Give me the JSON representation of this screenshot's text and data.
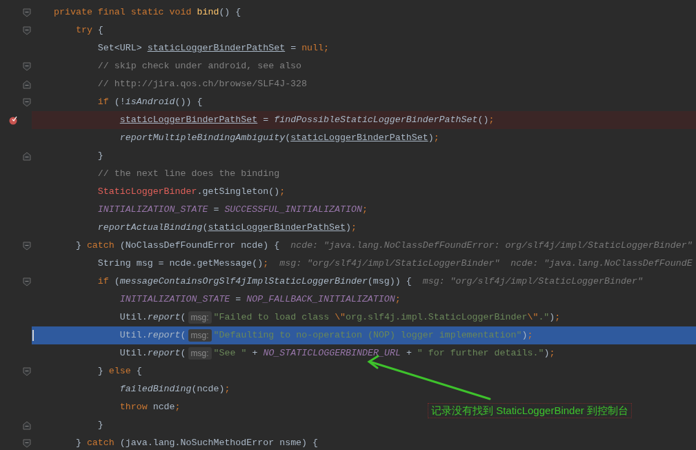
{
  "editor": {
    "lines": [
      {
        "breakpoint": false,
        "current": false,
        "fold_open": true,
        "fold_close": false,
        "tokens": [
          {
            "kind": "kw",
            "text": "private final static void "
          },
          {
            "kind": "fn",
            "text": "bind"
          },
          {
            "kind": "p",
            "text": "() {"
          }
        ]
      },
      {
        "breakpoint": false,
        "current": false,
        "fold_open": true,
        "fold_close": false,
        "tokens": [
          {
            "kind": "kw",
            "text": "    try"
          },
          {
            "kind": "p",
            "text": " {"
          }
        ]
      },
      {
        "breakpoint": false,
        "current": false,
        "fold_open": false,
        "fold_close": false,
        "tokens": [
          {
            "kind": "p",
            "text": "        Set<URL> "
          },
          {
            "kind": "u",
            "text": "staticLoggerBinderPathSet"
          },
          {
            "kind": "p",
            "text": " = "
          },
          {
            "kind": "kw",
            "text": "null;"
          }
        ]
      },
      {
        "breakpoint": false,
        "current": false,
        "fold_open": true,
        "fold_close": false,
        "tokens": [
          {
            "kind": "c",
            "text": "        // skip check under android, see also"
          }
        ]
      },
      {
        "breakpoint": false,
        "current": false,
        "fold_open": false,
        "fold_close": true,
        "tokens": [
          {
            "kind": "c",
            "text": "        // http://jira.qos.ch/browse/SLF4J-328"
          }
        ]
      },
      {
        "breakpoint": false,
        "current": false,
        "fold_open": true,
        "fold_close": false,
        "tokens": [
          {
            "kind": "kw",
            "text": "        if"
          },
          {
            "kind": "p",
            "text": " (!"
          },
          {
            "kind": "m",
            "text": "isAndroid"
          },
          {
            "kind": "p",
            "text": "()) {"
          }
        ]
      },
      {
        "breakpoint": true,
        "current": false,
        "fold_open": false,
        "fold_close": false,
        "tokens": [
          {
            "kind": "u",
            "text": "            staticLoggerBinderPathSet"
          },
          {
            "kind": "p",
            "text": " = "
          },
          {
            "kind": "m",
            "text": "findPossibleStaticLoggerBinderPathSet"
          },
          {
            "kind": "p",
            "text": "()"
          },
          {
            "kind": "kw",
            "text": ";"
          }
        ]
      },
      {
        "breakpoint": false,
        "current": false,
        "fold_open": false,
        "fold_close": false,
        "tokens": [
          {
            "kind": "m",
            "text": "            reportMultipleBindingAmbiguity"
          },
          {
            "kind": "p",
            "text": "("
          },
          {
            "kind": "u",
            "text": "staticLoggerBinderPathSet"
          },
          {
            "kind": "p",
            "text": ")"
          },
          {
            "kind": "kw",
            "text": ";"
          }
        ]
      },
      {
        "breakpoint": false,
        "current": false,
        "fold_open": false,
        "fold_close": true,
        "tokens": [
          {
            "kind": "p",
            "text": "        }"
          }
        ]
      },
      {
        "breakpoint": false,
        "current": false,
        "fold_open": false,
        "fold_close": false,
        "tokens": [
          {
            "kind": "c",
            "text": "        // the next line does the binding"
          }
        ]
      },
      {
        "breakpoint": false,
        "current": false,
        "fold_open": false,
        "fold_close": false,
        "tokens": [
          {
            "kind": "cls",
            "text": "        StaticLoggerBinder"
          },
          {
            "kind": "p",
            "text": ".getSingleton()"
          },
          {
            "kind": "kw",
            "text": ";"
          }
        ]
      },
      {
        "breakpoint": false,
        "current": false,
        "fold_open": false,
        "fold_close": false,
        "tokens": [
          {
            "kind": "k",
            "text": "        INITIALIZATION_STATE"
          },
          {
            "kind": "p",
            "text": " = "
          },
          {
            "kind": "k",
            "text": "SUCCESSFUL_INITIALIZATION"
          },
          {
            "kind": "kw",
            "text": ";"
          }
        ]
      },
      {
        "breakpoint": false,
        "current": false,
        "fold_open": false,
        "fold_close": false,
        "tokens": [
          {
            "kind": "m",
            "text": "        reportActualBinding"
          },
          {
            "kind": "p",
            "text": "("
          },
          {
            "kind": "u",
            "text": "staticLoggerBinderPathSet"
          },
          {
            "kind": "p",
            "text": ")"
          },
          {
            "kind": "kw",
            "text": ";"
          }
        ]
      },
      {
        "breakpoint": false,
        "current": false,
        "fold_open": true,
        "fold_close": false,
        "tokens": [
          {
            "kind": "p",
            "text": "    } "
          },
          {
            "kind": "kw",
            "text": "catch"
          },
          {
            "kind": "p",
            "text": " (NoClassDefFoundError ncde) {"
          },
          {
            "kind": "hint",
            "text": "ncde: \"java.lang.NoClassDefFoundError: org/slf4j/impl/StaticLoggerBinder\""
          }
        ]
      },
      {
        "breakpoint": false,
        "current": false,
        "fold_open": false,
        "fold_close": false,
        "tokens": [
          {
            "kind": "p",
            "text": "        String msg = ncde.getMessage()"
          },
          {
            "kind": "kw",
            "text": ";"
          },
          {
            "kind": "hint",
            "text": "msg: \"org/slf4j/impl/StaticLoggerBinder\"  ncde: \"java.lang.NoClassDefFoundE"
          }
        ]
      },
      {
        "breakpoint": false,
        "current": false,
        "fold_open": true,
        "fold_close": false,
        "tokens": [
          {
            "kind": "kw",
            "text": "        if"
          },
          {
            "kind": "p",
            "text": " ("
          },
          {
            "kind": "m",
            "text": "messageContainsOrgSlf4jImplStaticLoggerBinder"
          },
          {
            "kind": "p",
            "text": "(msg)) {"
          },
          {
            "kind": "hint",
            "text": "msg: \"org/slf4j/impl/StaticLoggerBinder\""
          }
        ]
      },
      {
        "breakpoint": false,
        "current": false,
        "fold_open": false,
        "fold_close": false,
        "tokens": [
          {
            "kind": "k",
            "text": "            INITIALIZATION_STATE"
          },
          {
            "kind": "p",
            "text": " = "
          },
          {
            "kind": "k",
            "text": "NOP_FALLBACK_INITIALIZATION"
          },
          {
            "kind": "kw",
            "text": ";"
          }
        ]
      },
      {
        "breakpoint": false,
        "current": false,
        "fold_open": false,
        "fold_close": false,
        "tokens": [
          {
            "kind": "p",
            "text": "            Util."
          },
          {
            "kind": "m",
            "text": "report"
          },
          {
            "kind": "p",
            "text": "("
          },
          {
            "kind": "param",
            "text": "msg:"
          },
          {
            "kind": "s",
            "text": "\"Failed to load class "
          },
          {
            "kind": "kw",
            "text": "\\\""
          },
          {
            "kind": "s",
            "text": "org.slf4j.impl.StaticLoggerBinder"
          },
          {
            "kind": "kw",
            "text": "\\\""
          },
          {
            "kind": "s",
            "text": ".\""
          },
          {
            "kind": "p",
            "text": ")"
          },
          {
            "kind": "kw",
            "text": ";"
          }
        ]
      },
      {
        "breakpoint": false,
        "current": true,
        "fold_open": false,
        "fold_close": false,
        "tokens": [
          {
            "kind": "p",
            "text": "            Util."
          },
          {
            "kind": "m",
            "text": "report"
          },
          {
            "kind": "p",
            "text": "("
          },
          {
            "kind": "param",
            "text": "msg:"
          },
          {
            "kind": "s",
            "text": "\"Defaulting to no-operation (NOP) logger implementation\""
          },
          {
            "kind": "p",
            "text": ")"
          },
          {
            "kind": "kw",
            "text": ";"
          }
        ]
      },
      {
        "breakpoint": false,
        "current": false,
        "fold_open": false,
        "fold_close": false,
        "tokens": [
          {
            "kind": "p",
            "text": "            Util."
          },
          {
            "kind": "m",
            "text": "report"
          },
          {
            "kind": "p",
            "text": "("
          },
          {
            "kind": "param",
            "text": "msg:"
          },
          {
            "kind": "s",
            "text": "\"See \""
          },
          {
            "kind": "p",
            "text": " + "
          },
          {
            "kind": "k",
            "text": "NO_STATICLOGGERBINDER_URL"
          },
          {
            "kind": "p",
            "text": " + "
          },
          {
            "kind": "s",
            "text": "\" for further details.\""
          },
          {
            "kind": "p",
            "text": ")"
          },
          {
            "kind": "kw",
            "text": ";"
          }
        ]
      },
      {
        "breakpoint": false,
        "current": false,
        "fold_open": true,
        "fold_close": false,
        "tokens": [
          {
            "kind": "p",
            "text": "        } "
          },
          {
            "kind": "kw",
            "text": "else"
          },
          {
            "kind": "p",
            "text": " {"
          }
        ]
      },
      {
        "breakpoint": false,
        "current": false,
        "fold_open": false,
        "fold_close": false,
        "tokens": [
          {
            "kind": "m",
            "text": "            failedBinding"
          },
          {
            "kind": "p",
            "text": "(ncde)"
          },
          {
            "kind": "kw",
            "text": ";"
          }
        ]
      },
      {
        "breakpoint": false,
        "current": false,
        "fold_open": false,
        "fold_close": false,
        "tokens": [
          {
            "kind": "kw",
            "text": "            throw"
          },
          {
            "kind": "p",
            "text": " ncde"
          },
          {
            "kind": "kw",
            "text": ";"
          }
        ]
      },
      {
        "breakpoint": false,
        "current": false,
        "fold_open": false,
        "fold_close": true,
        "tokens": [
          {
            "kind": "p",
            "text": "        }"
          }
        ]
      },
      {
        "breakpoint": false,
        "current": false,
        "fold_open": true,
        "fold_close": false,
        "tokens": [
          {
            "kind": "p",
            "text": "    } "
          },
          {
            "kind": "kw",
            "text": "catch"
          },
          {
            "kind": "p",
            "text": " (java.lang.NoSuchMethodError nsme) {"
          }
        ]
      }
    ]
  },
  "annotation": {
    "text": "记录没有找到 StaticLoggerBinder 到控制台"
  }
}
